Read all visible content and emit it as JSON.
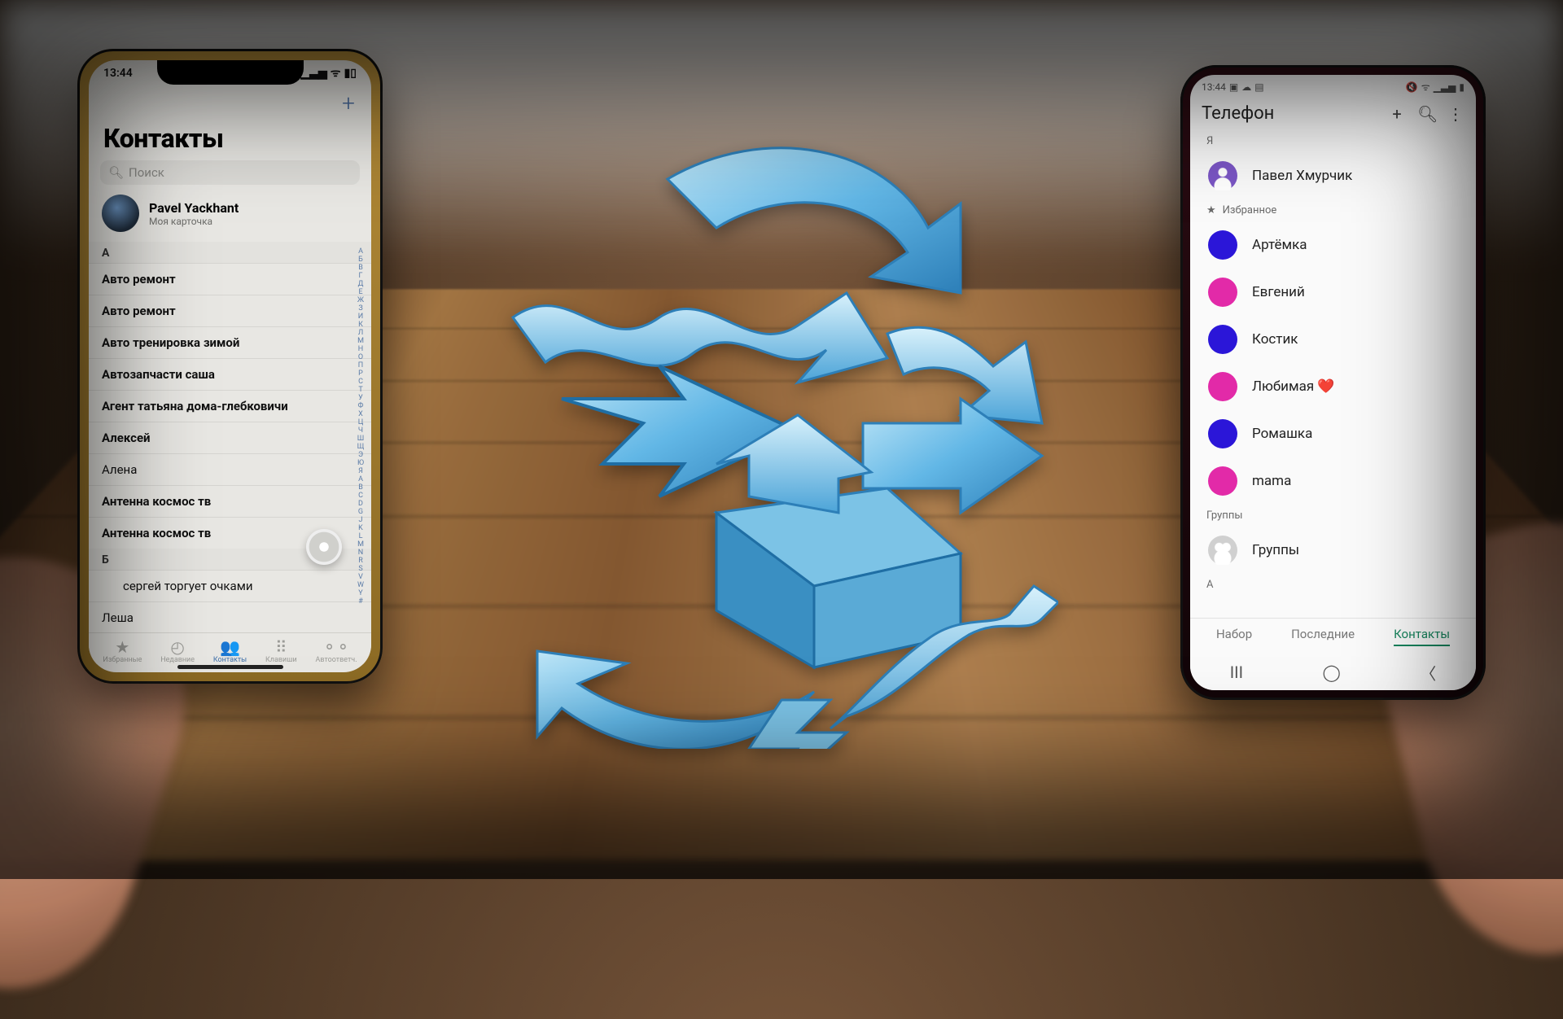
{
  "iphone": {
    "status_time": "13:44",
    "title": "Контакты",
    "search_placeholder": "Поиск",
    "me": {
      "name": "Pavel Yackhant",
      "subtitle": "Моя карточка"
    },
    "index_letters": [
      "А",
      "Б",
      "В",
      "Г",
      "Д",
      "Е",
      "Ж",
      "З",
      "И",
      "К",
      "Л",
      "М",
      "Н",
      "О",
      "П",
      "Р",
      "С",
      "Т",
      "У",
      "Ф",
      "Х",
      "Ц",
      "Ч",
      "Ш",
      "Щ",
      "Э",
      "Ю",
      "Я",
      "A",
      "B",
      "C",
      "D",
      "G",
      "J",
      "K",
      "L",
      "M",
      "N",
      "R",
      "S",
      "V",
      "W",
      "Y",
      "#"
    ],
    "sections": [
      {
        "letter": "А",
        "rows": [
          "Авто ремонт",
          "Авто ремонт",
          "Авто тренировка зимой",
          "Автозапчасти саша",
          "Агент татьяна дома-глебковичи",
          "Алексей",
          "Алена",
          "Антенна космос тв",
          "Антенна космос тв"
        ]
      },
      {
        "letter": "Б",
        "rows": [
          "сергей торгует очками",
          "Леша"
        ]
      }
    ],
    "tabs": [
      {
        "icon": "★",
        "label": "Избранные"
      },
      {
        "icon": "◴",
        "label": "Недавние"
      },
      {
        "icon": "👥",
        "label": "Контакты",
        "active": true
      },
      {
        "icon": "⠿",
        "label": "Клавиши"
      },
      {
        "icon": "⚬⚬",
        "label": "Автоответч."
      }
    ]
  },
  "android": {
    "status_time": "13:44",
    "title": "Телефон",
    "section_me": "Я",
    "me_name": "Павел Хмурчик",
    "section_fav": "Избранное",
    "favorites": [
      {
        "name": "Артёмка",
        "color": "blue"
      },
      {
        "name": "Евгений",
        "color": "magenta"
      },
      {
        "name": "Костик",
        "color": "blue"
      },
      {
        "name": "Любимая ❤️",
        "color": "magenta"
      },
      {
        "name": "Ромашка",
        "color": "blue"
      },
      {
        "name": "mama",
        "color": "magenta"
      }
    ],
    "section_groups": "Группы",
    "groups_label": "Группы",
    "section_a": "А",
    "bottom_tabs": [
      {
        "label": "Набор"
      },
      {
        "label": "Последние"
      },
      {
        "label": "Контакты",
        "active": true
      }
    ]
  }
}
